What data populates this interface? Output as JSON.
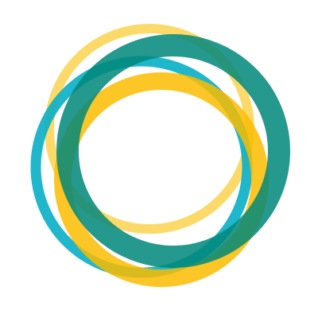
{
  "logo": {
    "kind": "interlocking-rings-mark",
    "background_color": "#ffffff",
    "rings": [
      {
        "name": "light-yellow-ring",
        "color": "#f9c61a",
        "opacity": 0.65
      },
      {
        "name": "cyan-ring",
        "color": "#08aec5",
        "opacity": 0.9
      },
      {
        "name": "yellow-ring",
        "color": "#fbbc00",
        "opacity": 0.85
      },
      {
        "name": "teal-ring",
        "color": "#00877a",
        "opacity": 0.85
      }
    ]
  }
}
